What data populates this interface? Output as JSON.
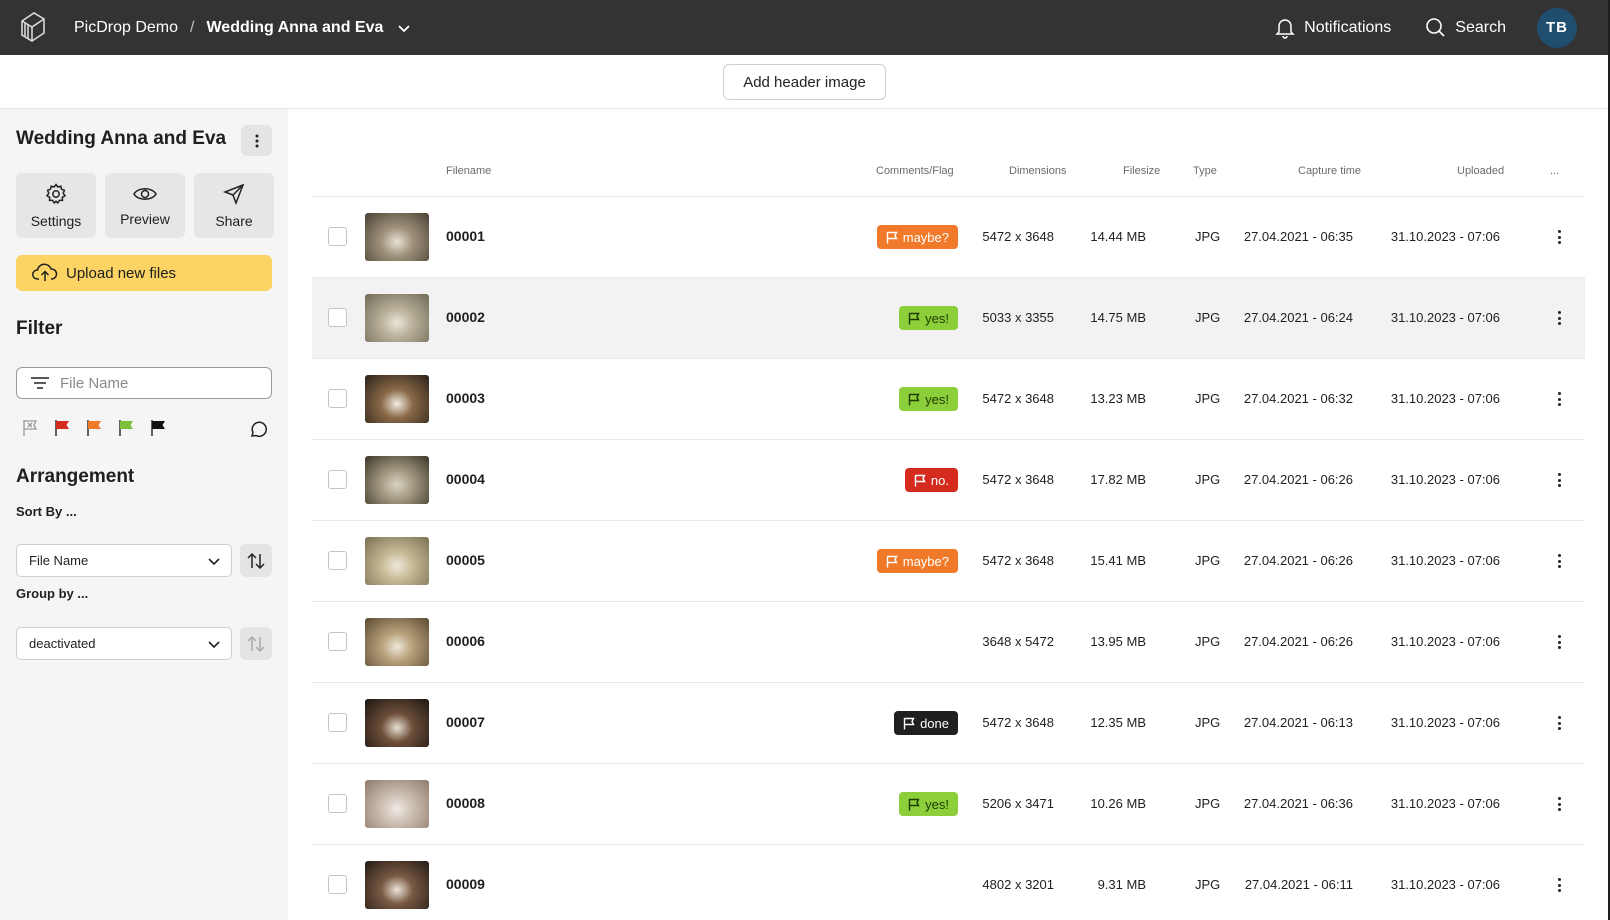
{
  "topbar": {
    "workspace": "PicDrop Demo",
    "separator": "/",
    "gallery": "Wedding Anna and Eva",
    "notifications_label": "Notifications",
    "search_label": "Search",
    "avatar_initials": "TB"
  },
  "header": {
    "add_header_image_label": "Add header image"
  },
  "sidebar": {
    "title": "Wedding Anna and Eva",
    "actions": [
      {
        "label": "Settings",
        "icon": "gear-icon"
      },
      {
        "label": "Preview",
        "icon": "eye-icon"
      },
      {
        "label": "Share",
        "icon": "send-icon"
      }
    ],
    "upload_label": "Upload new files",
    "filter_heading": "Filter",
    "filter_placeholder": "File Name",
    "flag_filters": [
      {
        "name": "no-flag",
        "color": "#9a9a9a"
      },
      {
        "name": "red",
        "color": "#d52b1e"
      },
      {
        "name": "orange",
        "color": "#f07a2a"
      },
      {
        "name": "green",
        "color": "#7bbf3a"
      },
      {
        "name": "black",
        "color": "#111111"
      }
    ],
    "arrangement_heading": "Arrangement",
    "sort_label": "Sort By ...",
    "sort_value": "File Name",
    "group_label": "Group by ...",
    "group_value": "deactivated"
  },
  "table": {
    "columns": {
      "filename": "Filename",
      "comments": "Comments/Flag",
      "dimensions": "Dimensions",
      "filesize": "Filesize",
      "type": "Type",
      "capture": "Capture time",
      "uploaded": "Uploaded",
      "more": "..."
    },
    "rows": [
      {
        "name": "00001",
        "flag": "maybe?",
        "flag_color": "orange",
        "dimensions": "5472 x 3648",
        "size": "14.44 MB",
        "type": "JPG",
        "capture": "27.04.2021 - 06:35",
        "uploaded": "31.10.2023 - 07:06",
        "thumb": [
          "#4a3f34",
          "#a0937c",
          "#e6e0d4"
        ]
      },
      {
        "name": "00002",
        "flag": "yes!",
        "flag_color": "green",
        "dimensions": "5033 x 3355",
        "size": "14.75 MB",
        "type": "JPG",
        "capture": "27.04.2021 - 06:24",
        "uploaded": "31.10.2023 - 07:06",
        "thumb": [
          "#6f6a55",
          "#b9b19a",
          "#e9e4d8"
        ]
      },
      {
        "name": "00003",
        "flag": "yes!",
        "flag_color": "green",
        "dimensions": "5472 x 3648",
        "size": "13.23 MB",
        "type": "JPG",
        "capture": "27.04.2021 - 06:32",
        "uploaded": "31.10.2023 - 07:06",
        "thumb": [
          "#2b2119",
          "#8a6a48",
          "#f1ece3"
        ]
      },
      {
        "name": "00004",
        "flag": "no.",
        "flag_color": "red",
        "dimensions": "5472 x 3648",
        "size": "17.82 MB",
        "type": "JPG",
        "capture": "27.04.2021 - 06:26",
        "uploaded": "31.10.2023 - 07:06",
        "thumb": [
          "#3a3528",
          "#a59c83",
          "#d9d3c3"
        ]
      },
      {
        "name": "00005",
        "flag": "maybe?",
        "flag_color": "orange",
        "dimensions": "5472 x 3648",
        "size": "15.41 MB",
        "type": "JPG",
        "capture": "27.04.2021 - 06:26",
        "uploaded": "31.10.2023 - 07:06",
        "thumb": [
          "#7a6f52",
          "#c6b995",
          "#efe9da"
        ]
      },
      {
        "name": "00006",
        "flag": "",
        "flag_color": "",
        "dimensions": "3648 x 5472",
        "size": "13.95 MB",
        "type": "JPG",
        "capture": "27.04.2021 - 06:26",
        "uploaded": "31.10.2023 - 07:06",
        "thumb": [
          "#5b4a33",
          "#b7a07a",
          "#eee7d8"
        ]
      },
      {
        "name": "00007",
        "flag": "done",
        "flag_color": "black",
        "dimensions": "5472 x 3648",
        "size": "12.35 MB",
        "type": "JPG",
        "capture": "27.04.2021 - 06:13",
        "uploaded": "31.10.2023 - 07:06",
        "thumb": [
          "#1b1512",
          "#6e4f3a",
          "#e8dfd2"
        ]
      },
      {
        "name": "00008",
        "flag": "yes!",
        "flag_color": "green",
        "dimensions": "5206 x 3471",
        "size": "10.26 MB",
        "type": "JPG",
        "capture": "27.04.2021 - 06:36",
        "uploaded": "31.10.2023 - 07:06",
        "thumb": [
          "#8c7a6c",
          "#cdbfb3",
          "#f0ebe6"
        ]
      },
      {
        "name": "00009",
        "flag": "",
        "flag_color": "",
        "dimensions": "4802 x 3201",
        "size": "9.31 MB",
        "type": "JPG",
        "capture": "27.04.2021 - 06:11",
        "uploaded": "31.10.2023 - 07:06",
        "thumb": [
          "#221a15",
          "#7a5a44",
          "#ece3d7"
        ]
      }
    ]
  }
}
